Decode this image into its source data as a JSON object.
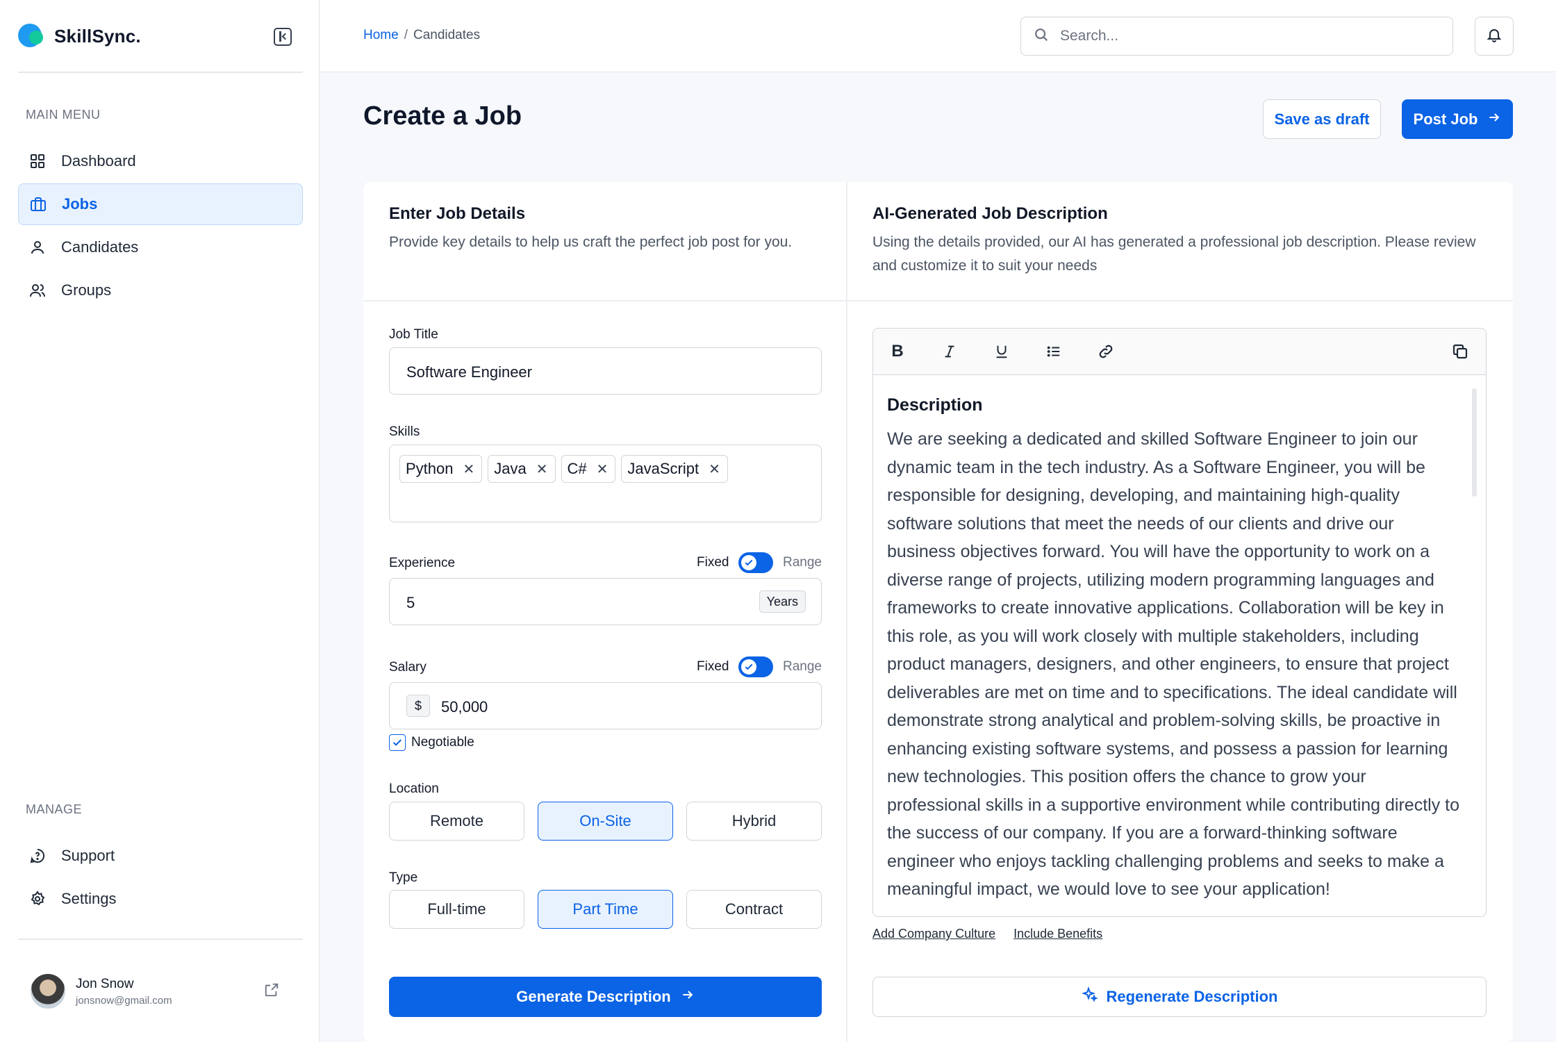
{
  "brand": {
    "name": "SkillSync."
  },
  "sidebar": {
    "main_menu_label": "MAIN MENU",
    "manage_label": "MANAGE",
    "items": [
      {
        "label": "Dashboard",
        "icon": "grid-icon"
      },
      {
        "label": "Jobs",
        "icon": "briefcase-icon",
        "active": true
      },
      {
        "label": "Candidates",
        "icon": "user-icon"
      },
      {
        "label": "Groups",
        "icon": "users-icon"
      }
    ],
    "manage_items": [
      {
        "label": "Support",
        "icon": "help-icon"
      },
      {
        "label": "Settings",
        "icon": "gear-icon"
      }
    ],
    "user": {
      "name": "Jon Snow",
      "email": "jonsnow@gmail.com"
    }
  },
  "topbar": {
    "breadcrumb": {
      "home": "Home",
      "separator": "/",
      "current": "Candidates"
    },
    "search_placeholder": "Search..."
  },
  "header": {
    "title": "Create a Job",
    "save_draft": "Save as draft",
    "post_job": "Post Job"
  },
  "details": {
    "title": "Enter Job Details",
    "subtitle": "Provide key details to help us craft the perfect job post for you.",
    "job_title_label": "Job Title",
    "job_title_value": "Software Engineer",
    "skills_label": "Skills",
    "skills": [
      "Python",
      "Java",
      "C#",
      "JavaScript"
    ],
    "experience_label": "Experience",
    "experience_value": "5",
    "experience_unit": "Years",
    "salary_label": "Salary",
    "salary_currency": "$",
    "salary_value": "50,000",
    "toggle_fixed": "Fixed",
    "toggle_range": "Range",
    "negotiable_label": "Negotiable",
    "negotiable_checked": true,
    "location_label": "Location",
    "location_options": [
      "Remote",
      "On-Site",
      "Hybrid"
    ],
    "location_selected": "On-Site",
    "type_label": "Type",
    "type_options": [
      "Full-time",
      "Part Time",
      "Contract"
    ],
    "type_selected": "Part Time",
    "generate_button": "Generate Description"
  },
  "ai": {
    "title": "AI-Generated Job Description",
    "subtitle": "Using the details provided, our AI has generated a professional job description. Please review and customize it to suit your needs",
    "editor_heading": "Description",
    "editor_text": "We are seeking a dedicated and skilled Software Engineer to join our dynamic team in the tech industry. As a Software Engineer, you will be responsible for designing, developing, and maintaining high-quality software solutions that meet the needs of our clients and drive our business objectives forward. You will have the opportunity to work on a diverse range of projects, utilizing modern programming languages and frameworks to create innovative applications. Collaboration will be key in this role, as you will work closely with multiple stakeholders, including product managers, designers, and other engineers, to ensure that project deliverables are met on time and to specifications. The ideal candidate will demonstrate strong analytical and problem-solving skills, be proactive in enhancing existing software systems, and possess a passion for learning new technologies. This position offers the chance to grow your professional skills in a supportive environment while contributing directly to the success of our company. If you are a forward-thinking software engineer who enjoys tackling challenging problems and seeks to make a meaningful impact, we would love to see your application!",
    "links": [
      "Add Company Culture",
      "Include Benefits"
    ],
    "regenerate_button": "Regenerate Description"
  },
  "colors": {
    "accent": "#0b63e5",
    "brand_blue": "#1e9bf0",
    "brand_green": "#12c99b"
  }
}
